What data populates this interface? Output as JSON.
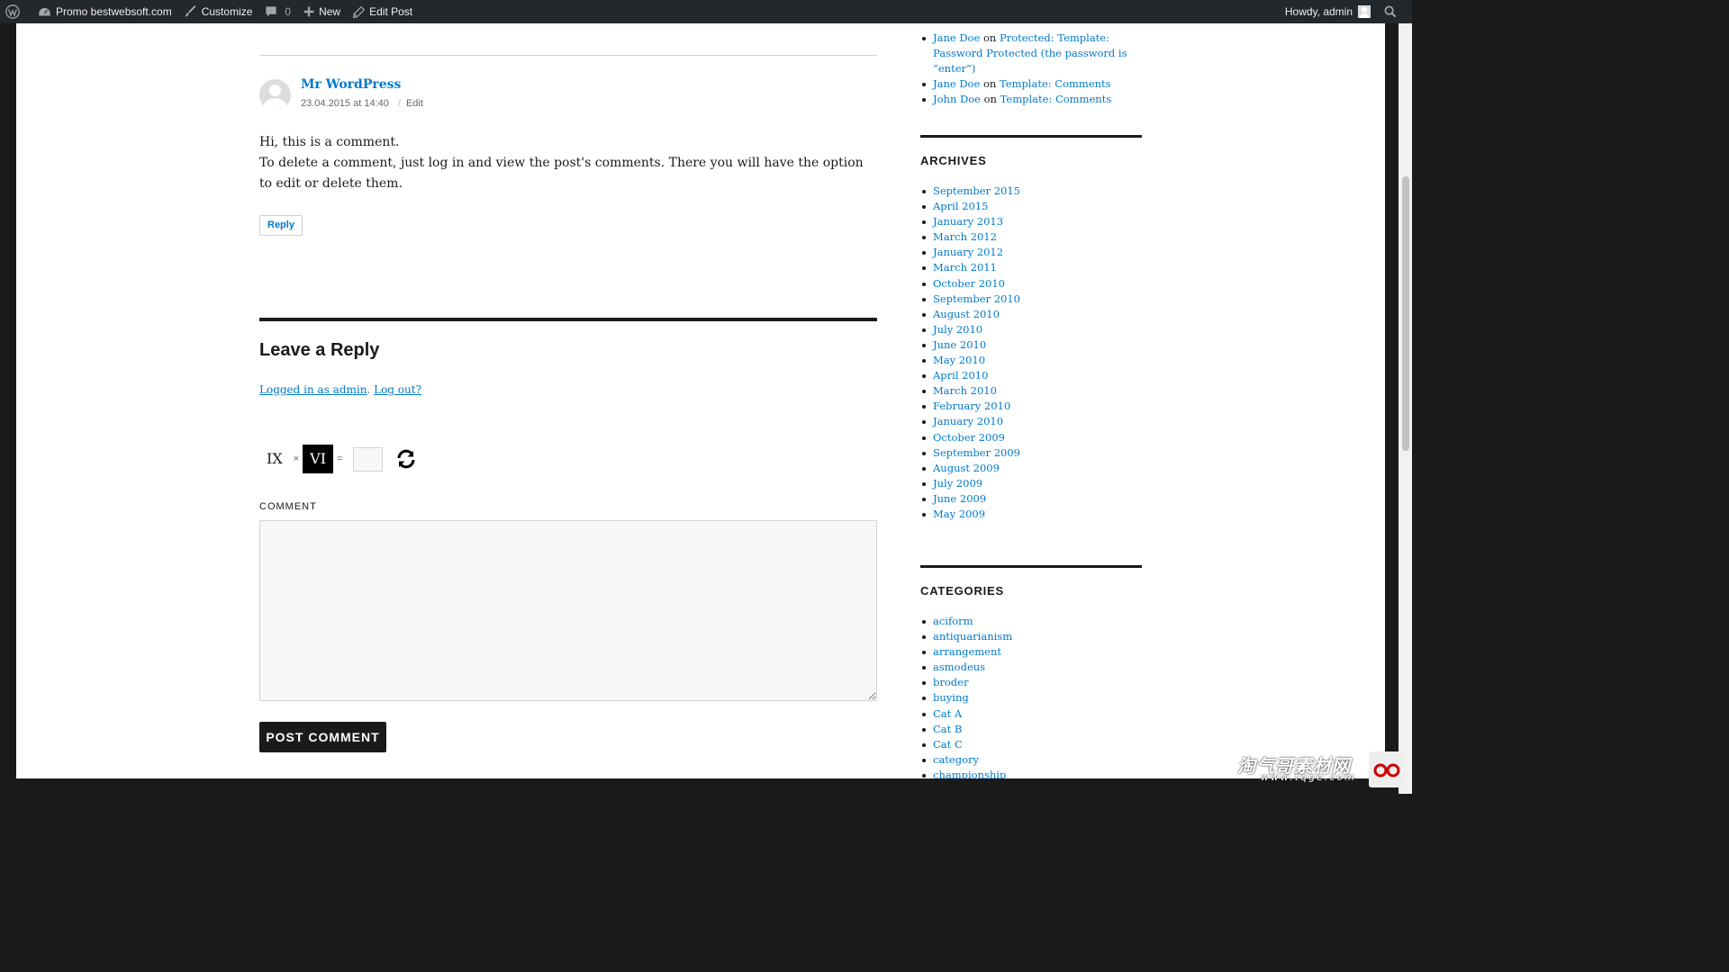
{
  "adminbar": {
    "site_name": "Promo bestwebsoft.com",
    "customize": "Customize",
    "comments_count": "0",
    "new": "New",
    "edit_post": "Edit Post",
    "howdy": "Howdy, admin"
  },
  "comment": {
    "author": "Mr WordPress",
    "date": "23.04.2015 at 14:40",
    "edit": "Edit",
    "line1": "Hi, this is a comment.",
    "line2": "To delete a comment, just log in and view the post's comments. There you will have the option to edit or delete them.",
    "reply": "Reply"
  },
  "reply_form": {
    "title": "Leave a Reply",
    "logged_in_link": "Logged in as admin",
    "separator": ".",
    "logout_link": "Log out?",
    "captcha": {
      "operand1": "IX",
      "operator": "×",
      "operand2": "VI",
      "equals": "=",
      "answer": ""
    },
    "comment_label": "COMMENT",
    "comment_value": "",
    "submit": "POST COMMENT"
  },
  "sidebar": {
    "recent_comments": [
      {
        "author": "Jane Doe",
        "on": "on",
        "post": "Protected: Template: Password Protected (the password is “enter”)"
      },
      {
        "author": "Jane Doe",
        "on": "on",
        "post": "Template: Comments"
      },
      {
        "author": "John Doe",
        "on": "on",
        "post": "Template: Comments"
      }
    ],
    "archives_title": "ARCHIVES",
    "archives": [
      "September 2015",
      "April 2015",
      "January 2013",
      "March 2012",
      "January 2012",
      "March 2011",
      "October 2010",
      "September 2010",
      "August 2010",
      "July 2010",
      "June 2010",
      "May 2010",
      "April 2010",
      "March 2010",
      "February 2010",
      "January 2010",
      "October 2009",
      "September 2009",
      "August 2009",
      "July 2009",
      "June 2009",
      "May 2009"
    ],
    "categories_title": "CATEGORIES",
    "categories": [
      "aciform",
      "antiquarianism",
      "arrangement",
      "asmodeus",
      "broder",
      "buying",
      "Cat A",
      "Cat B",
      "Cat C",
      "category",
      "championship"
    ]
  },
  "watermark": {
    "main": "淘气哥素材网",
    "sub": "www.tqge.com"
  }
}
